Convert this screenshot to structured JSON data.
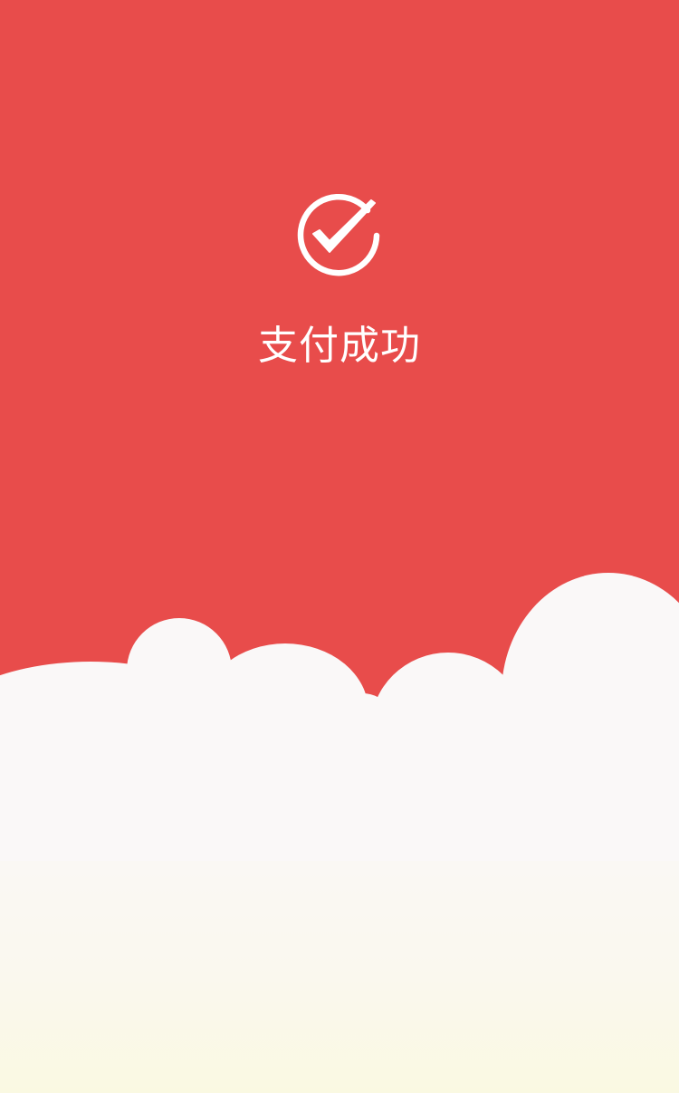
{
  "colors": {
    "background": "#E84C4B",
    "accent": "#FFFFFF",
    "cloud": "#FAF8F8",
    "bottom_gradient_end": "#FAF9E2"
  },
  "status": {
    "icon": "check-circle-icon",
    "message": "支付成功"
  }
}
